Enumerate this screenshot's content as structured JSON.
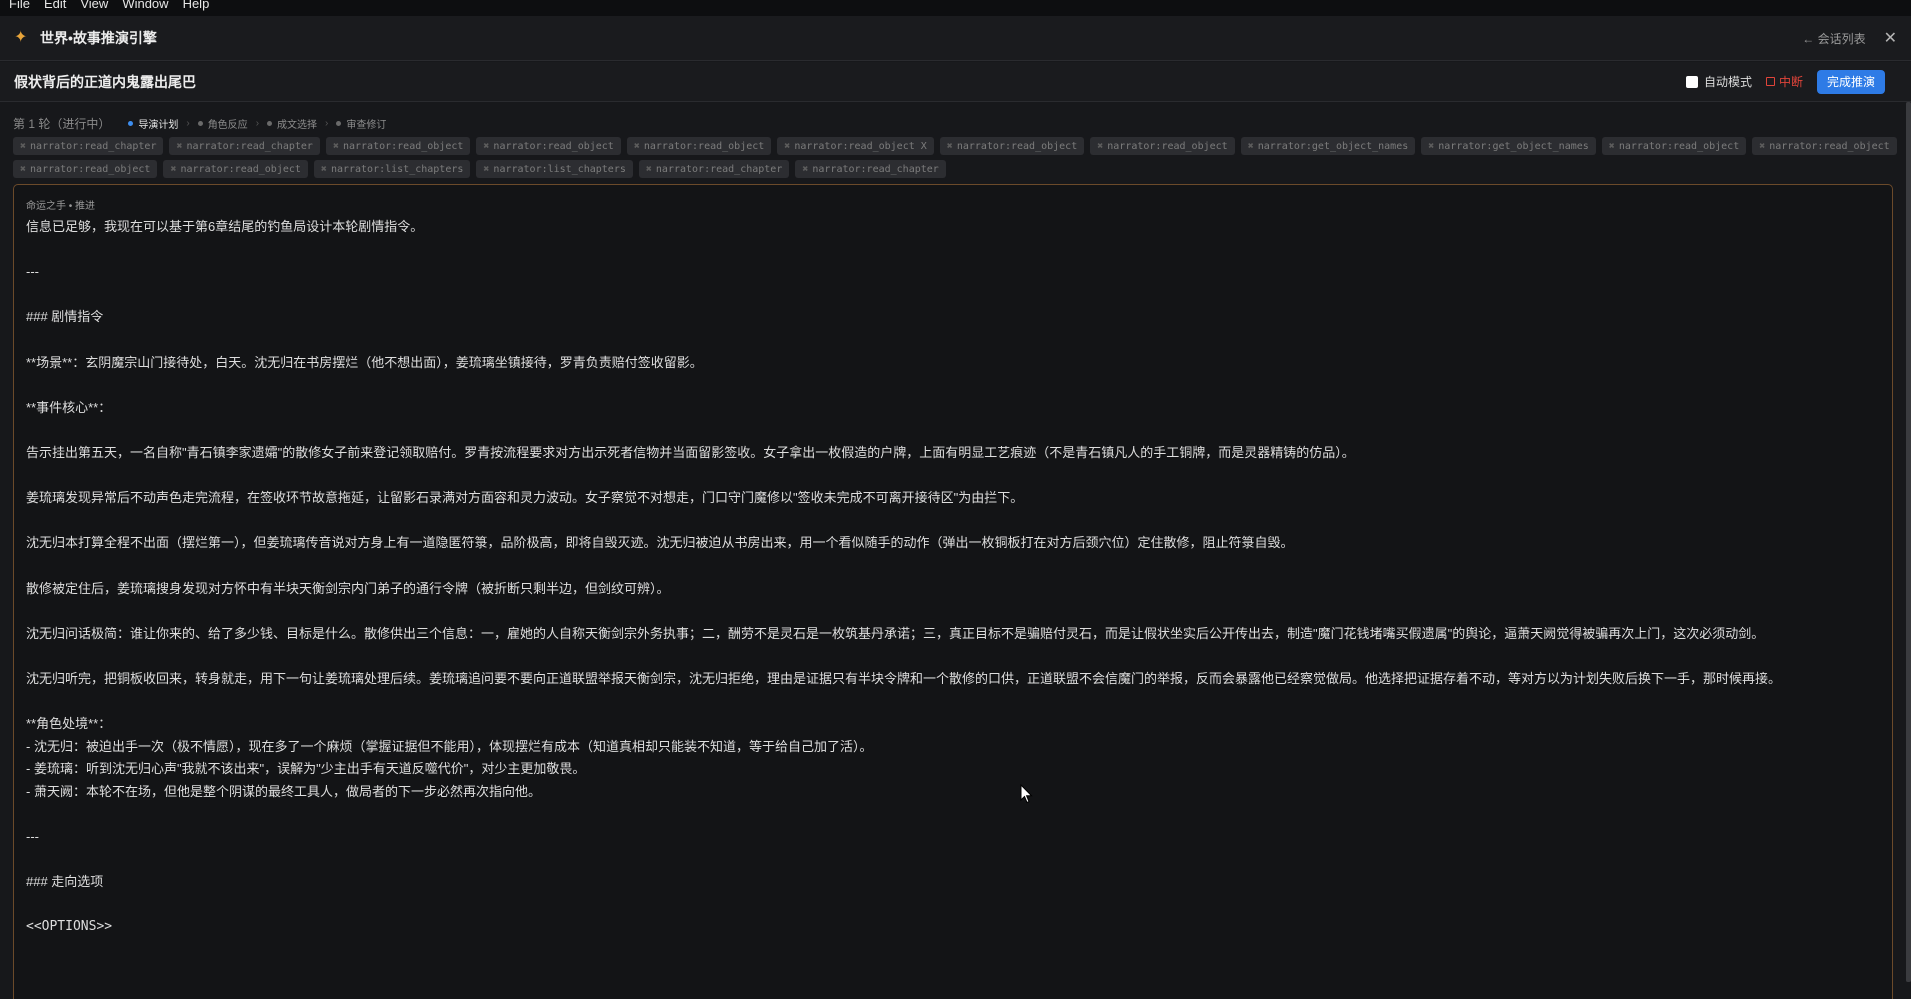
{
  "menubar": [
    "File",
    "Edit",
    "View",
    "Window",
    "Help"
  ],
  "app": {
    "title": "世界•故事推演引擎",
    "back_label": "← 会话列表",
    "close_icon": "close-icon"
  },
  "session": {
    "title": "假状背后的正道内鬼露出尾巴",
    "auto_mode_label": "自动模式",
    "auto_mode_checked": false,
    "stop_label": "中断",
    "finish_label": "完成推演"
  },
  "round": {
    "label": "第 1 轮（进行中）",
    "steps": [
      {
        "label": "导演计划",
        "active": true
      },
      {
        "label": "角色反应",
        "active": false
      },
      {
        "label": "成文选择",
        "active": false
      },
      {
        "label": "审查修订",
        "active": false
      }
    ]
  },
  "tool_chips": [
    "narrator:read_chapter",
    "narrator:read_chapter",
    "narrator:read_object",
    "narrator:read_object",
    "narrator:read_object",
    "narrator:read_object X",
    "narrator:read_object",
    "narrator:read_object",
    "narrator:get_object_names",
    "narrator:get_object_names",
    "narrator:read_object",
    "narrator:read_object",
    "narrator:read_object",
    "narrator:read_object",
    "narrator:list_chapters",
    "narrator:list_chapters",
    "narrator:read_chapter",
    "narrator:read_chapter"
  ],
  "output": {
    "label": "命运之手 • 推进",
    "lines": [
      "信息已足够，我现在可以基于第6章结尾的钓鱼局设计本轮剧情指令。",
      "",
      "---",
      "",
      "### 剧情指令",
      "",
      "**场景**：玄阴魔宗山门接待处，白天。沈无归在书房摆烂（他不想出面），姜琉璃坐镇接待，罗青负责赔付签收留影。",
      "",
      "**事件核心**：",
      "",
      "告示挂出第五天，一名自称\"青石镇李家遗孀\"的散修女子前来登记领取赔付。罗青按流程要求对方出示死者信物并当面留影签收。女子拿出一枚假造的户牌，上面有明显工艺痕迹（不是青石镇凡人的手工铜牌，而是灵器精铸的仿品）。",
      "",
      "姜琉璃发现异常后不动声色走完流程，在签收环节故意拖延，让留影石录满对方面容和灵力波动。女子察觉不对想走，门口守门魔修以\"签收未完成不可离开接待区\"为由拦下。",
      "",
      "沈无归本打算全程不出面（摆烂第一），但姜琉璃传音说对方身上有一道隐匿符箓，品阶极高，即将自毁灭迹。沈无归被迫从书房出来，用一个看似随手的动作（弹出一枚铜板打在对方后颈穴位）定住散修，阻止符箓自毁。",
      "",
      "散修被定住后，姜琉璃搜身发现对方怀中有半块天衡剑宗内门弟子的通行令牌（被折断只剩半边，但剑纹可辨）。",
      "",
      "沈无归问话极简：谁让你来的、给了多少钱、目标是什么。散修供出三个信息：一，雇她的人自称天衡剑宗外务执事；二，酬劳不是灵石是一枚筑基丹承诺；三，真正目标不是骗赔付灵石，而是让假状坐实后公开传出去，制造\"魔门花钱堵嘴买假遗属\"的舆论，逼萧天阙觉得被骗再次上门，这次必须动剑。",
      "",
      "沈无归听完，把铜板收回来，转身就走，用下一句让姜琉璃处理后续。姜琉璃追问要不要向正道联盟举报天衡剑宗，沈无归拒绝，理由是证据只有半块令牌和一个散修的口供，正道联盟不会信魔门的举报，反而会暴露他已经察觉做局。他选择把证据存着不动，等对方以为计划失败后换下一手，那时候再接。",
      "",
      "**角色处境**：",
      "- 沈无归：被迫出手一次（极不情愿），现在多了一个麻烦（掌握证据但不能用），体现摆烂有成本（知道真相却只能装不知道，等于给自己加了活）。",
      "- 姜琉璃：听到沈无归心声\"我就不该出来\"，误解为\"少主出手有天道反噬代价\"，对少主更加敬畏。",
      "- 萧天阙：本轮不在场，但他是整个阴谋的最终工具人，做局者的下一步必然再次指向他。",
      "",
      "---",
      "",
      "### 走向选项",
      "",
      "<<OPTIONS>>"
    ]
  }
}
